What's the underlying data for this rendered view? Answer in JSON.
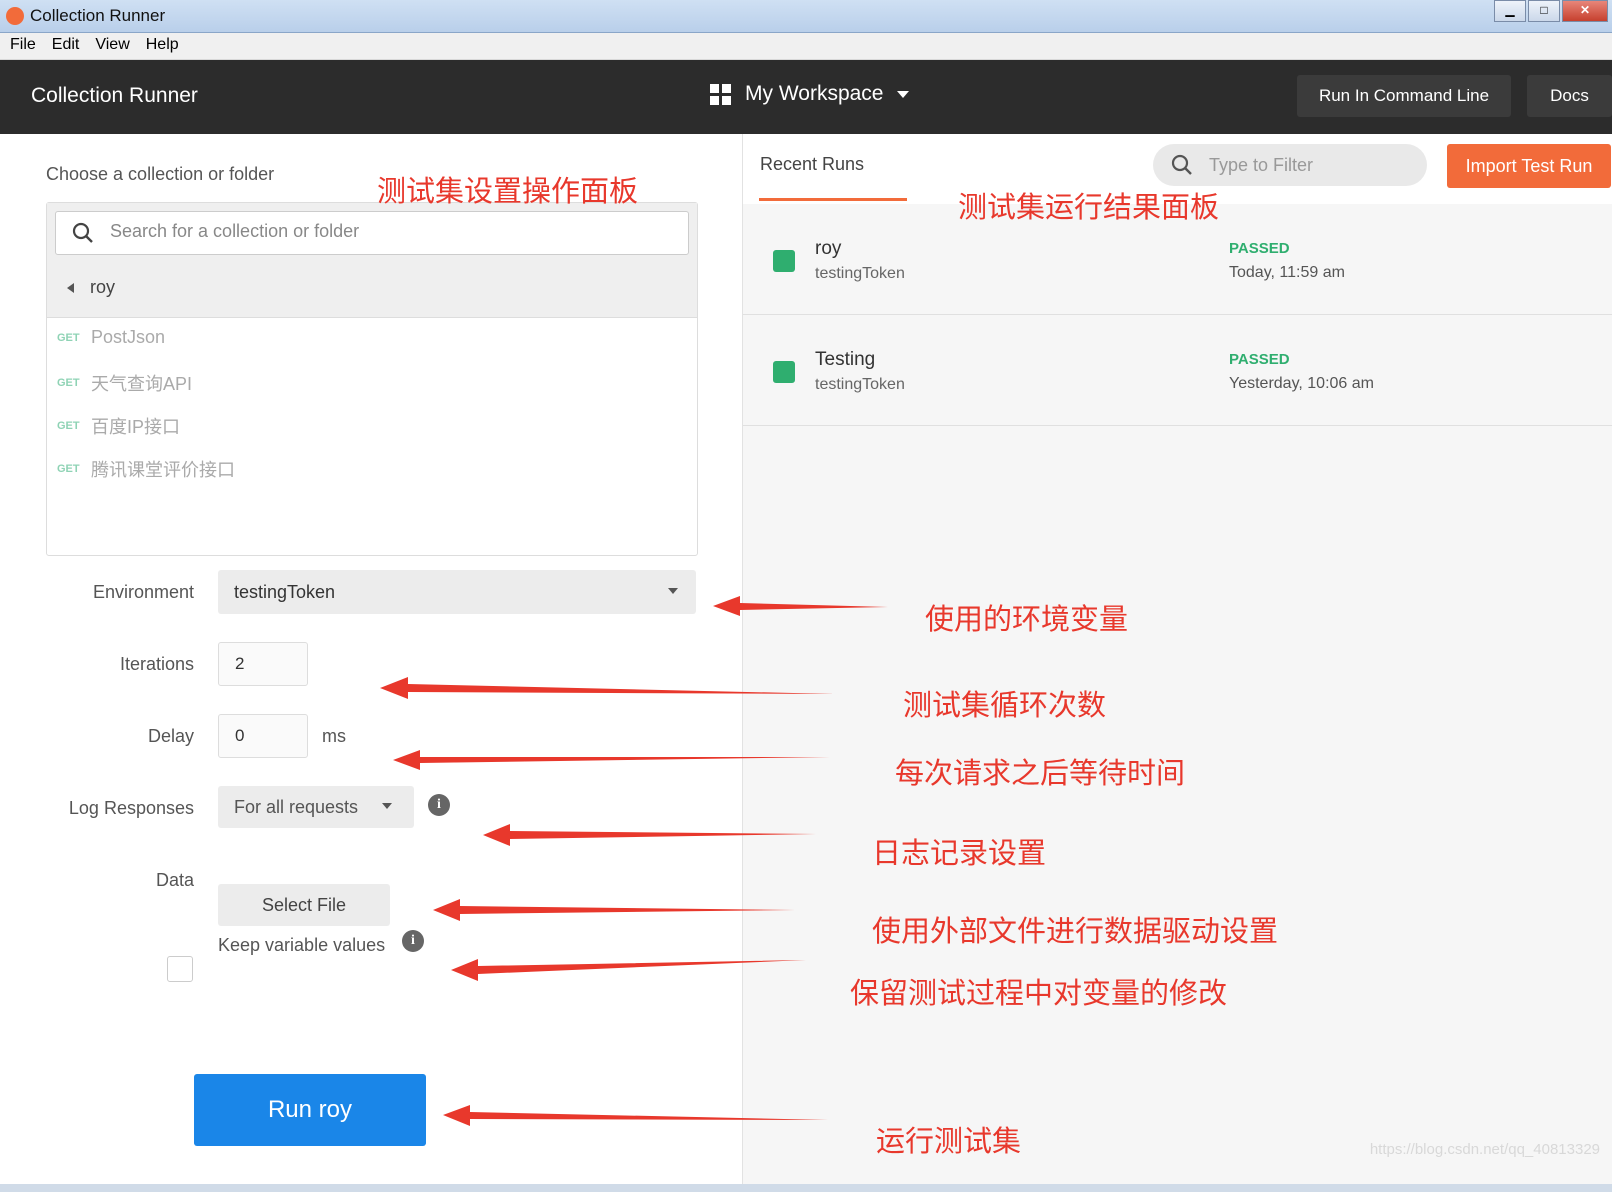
{
  "window": {
    "title": "Collection Runner"
  },
  "menu": [
    "File",
    "Edit",
    "View",
    "Help"
  ],
  "header": {
    "brand": "Collection Runner",
    "workspace": "My Workspace",
    "run_cli": "Run In Command Line",
    "docs": "Docs"
  },
  "left": {
    "choose_label": "Choose a collection or folder",
    "search_placeholder": "Search for a collection or folder",
    "collection": "roy",
    "requests": [
      {
        "method": "GET",
        "name": "PostJson"
      },
      {
        "method": "GET",
        "name": "天气查询API"
      },
      {
        "method": "GET",
        "name": "百度IP接口"
      },
      {
        "method": "GET",
        "name": "腾讯课堂评价接口"
      }
    ],
    "environment_label": "Environment",
    "environment_value": "testingToken",
    "iterations_label": "Iterations",
    "iterations_value": "2",
    "delay_label": "Delay",
    "delay_value": "0",
    "delay_unit": "ms",
    "log_label": "Log Responses",
    "log_value": "For all requests",
    "data_label": "Data",
    "select_file": "Select File",
    "keep_label": "Keep variable values",
    "run_button": "Run roy"
  },
  "right": {
    "tab": "Recent Runs",
    "filter_placeholder": "Type to Filter",
    "import_button": "Import Test Run",
    "runs": [
      {
        "name": "roy",
        "env": "testingToken",
        "status": "PASSED",
        "time": "Today, 11:59 am"
      },
      {
        "name": "Testing",
        "env": "testingToken",
        "status": "PASSED",
        "time": "Yesterday, 10:06 am"
      }
    ]
  },
  "annotations": {
    "left_panel": "测试集设置操作面板",
    "right_panel": "测试集运行结果面板",
    "environment": "使用的环境变量",
    "iterations": "测试集循环次数",
    "delay": "每次请求之后等待时间",
    "log": "日志记录设置",
    "data": "使用外部文件进行数据驱动设置",
    "keep": "保留测试过程中对变量的修改",
    "run": "运行测试集"
  },
  "watermark": "https://blog.csdn.net/qq_40813329",
  "colors": {
    "accent": "#f26b3a",
    "primary": "#1a86e8",
    "passed": "#2fae6f",
    "annotation": "#e8382c",
    "header": "#2c2c2c"
  }
}
